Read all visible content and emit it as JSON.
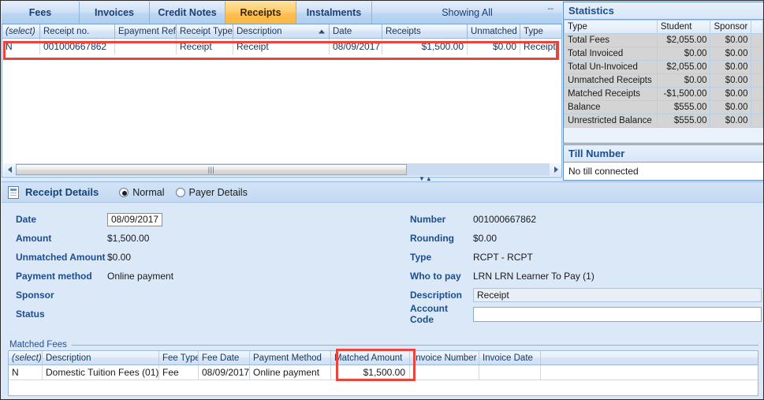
{
  "tabs": [
    {
      "label": "Fees",
      "active": false
    },
    {
      "label": "Invoices",
      "active": false
    },
    {
      "label": "Credit Notes",
      "active": false
    },
    {
      "label": "Receipts",
      "active": true
    },
    {
      "label": "Instalments",
      "active": false
    }
  ],
  "filter": {
    "label": "Showing All",
    "chevron": "chevron-double-down-icon",
    "glyph": "ˇˇ"
  },
  "receipts_grid": {
    "columns": [
      {
        "key": "select",
        "label": "(select)",
        "align": "left",
        "italic": true
      },
      {
        "key": "receipt_no",
        "label": "Receipt no.",
        "align": "left"
      },
      {
        "key": "epayment_ref",
        "label": "Epayment Ref",
        "align": "left"
      },
      {
        "key": "receipt_type",
        "label": "Receipt Type",
        "align": "left"
      },
      {
        "key": "description",
        "label": "Description",
        "align": "left",
        "sorted": "asc"
      },
      {
        "key": "date",
        "label": "Date",
        "align": "left"
      },
      {
        "key": "receipts",
        "label": "Receipts",
        "align": "left"
      },
      {
        "key": "unmatched",
        "label": "Unmatched",
        "align": "left"
      },
      {
        "key": "type",
        "label": "Type",
        "align": "left"
      }
    ],
    "rows": [
      {
        "select": "N",
        "receipt_no": "001000667862",
        "epayment_ref": "",
        "receipt_type": "Receipt",
        "description": "Receipt",
        "date": "08/09/2017",
        "receipts": "$1,500.00",
        "unmatched": "$0.00",
        "type": "Receipt",
        "highlighted": true
      }
    ]
  },
  "statistics": {
    "title": "Statistics",
    "columns": [
      "Type",
      "Student",
      "Sponsor"
    ],
    "rows": [
      {
        "type": "Total Fees",
        "student": "$2,055.00",
        "sponsor": "$0.00"
      },
      {
        "type": "Total Invoiced",
        "student": "$0.00",
        "sponsor": "$0.00"
      },
      {
        "type": "Total Un-Invoiced",
        "student": "$2,055.00",
        "sponsor": "$0.00"
      },
      {
        "type": "Unmatched Receipts",
        "student": "$0.00",
        "sponsor": "$0.00"
      },
      {
        "type": "Matched Receipts",
        "student": "-$1,500.00",
        "sponsor": "$0.00"
      },
      {
        "type": "Balance",
        "student": "$555.00",
        "sponsor": "$0.00"
      },
      {
        "type": "Unrestricted Balance",
        "student": "$555.00",
        "sponsor": "$0.00"
      }
    ]
  },
  "till": {
    "title": "Till Number",
    "value": "No till connected"
  },
  "details": {
    "title": "Receipt Details",
    "icon": "document-icon",
    "view_modes": [
      {
        "label": "Normal",
        "selected": true
      },
      {
        "label": "Payer Details",
        "selected": false
      }
    ],
    "left_fields": [
      {
        "label": "Date",
        "value": "08/09/2017",
        "style": "boxed"
      },
      {
        "label": "Amount",
        "value": "$1,500.00",
        "style": "text"
      },
      {
        "label": "Unmatched Amount",
        "value": "$0.00",
        "style": "text"
      },
      {
        "label": "Payment method",
        "value": "Online payment",
        "style": "text"
      },
      {
        "label": "Sponsor",
        "value": "",
        "style": "text"
      },
      {
        "label": "Status",
        "value": "",
        "style": "text"
      }
    ],
    "right_fields": [
      {
        "label": "Number",
        "value": "001000667862",
        "style": "text"
      },
      {
        "label": "Rounding",
        "value": "$0.00",
        "style": "text"
      },
      {
        "label": "Type",
        "value": "RCPT - RCPT",
        "style": "text"
      },
      {
        "label": "Who to pay",
        "value": "LRN   LRN Learner To Pay (1)",
        "style": "text"
      },
      {
        "label": "Description",
        "value": "Receipt",
        "style": "input-readonly"
      },
      {
        "label": "Account Code",
        "value": "",
        "style": "input"
      }
    ]
  },
  "matched_fees": {
    "legend": "Matched Fees",
    "columns": [
      {
        "key": "select",
        "label": "(select)",
        "italic": true
      },
      {
        "key": "description",
        "label": "Description"
      },
      {
        "key": "fee_type",
        "label": "Fee Type"
      },
      {
        "key": "fee_date",
        "label": "Fee Date"
      },
      {
        "key": "payment_method",
        "label": "Payment Method"
      },
      {
        "key": "matched_amount",
        "label": "Matched Amount",
        "align": "right",
        "highlighted": true
      },
      {
        "key": "invoice_number",
        "label": "Invoice Number"
      },
      {
        "key": "invoice_date",
        "label": "Invoice Date"
      }
    ],
    "rows": [
      {
        "select": "N",
        "description": "Domestic Tuition Fees (01)",
        "fee_type": "Fee",
        "fee_date": "08/09/2017",
        "payment_method": "Online payment",
        "matched_amount": "$1,500.00",
        "invoice_number": "",
        "invoice_date": ""
      }
    ]
  },
  "scrollbar": {
    "left_arrow": "arrow-left-icon",
    "right_arrow": "arrow-right-icon",
    "grip": "|||"
  },
  "colors": {
    "accent_tab_active": "#fbb73f",
    "highlight_red": "#e8453c",
    "panel_title_blue": "#1b4d8f",
    "field_label_blue": "#1b4d8f",
    "grid_text_blue": "#14365e",
    "background_blue": "#dbe8f8"
  }
}
